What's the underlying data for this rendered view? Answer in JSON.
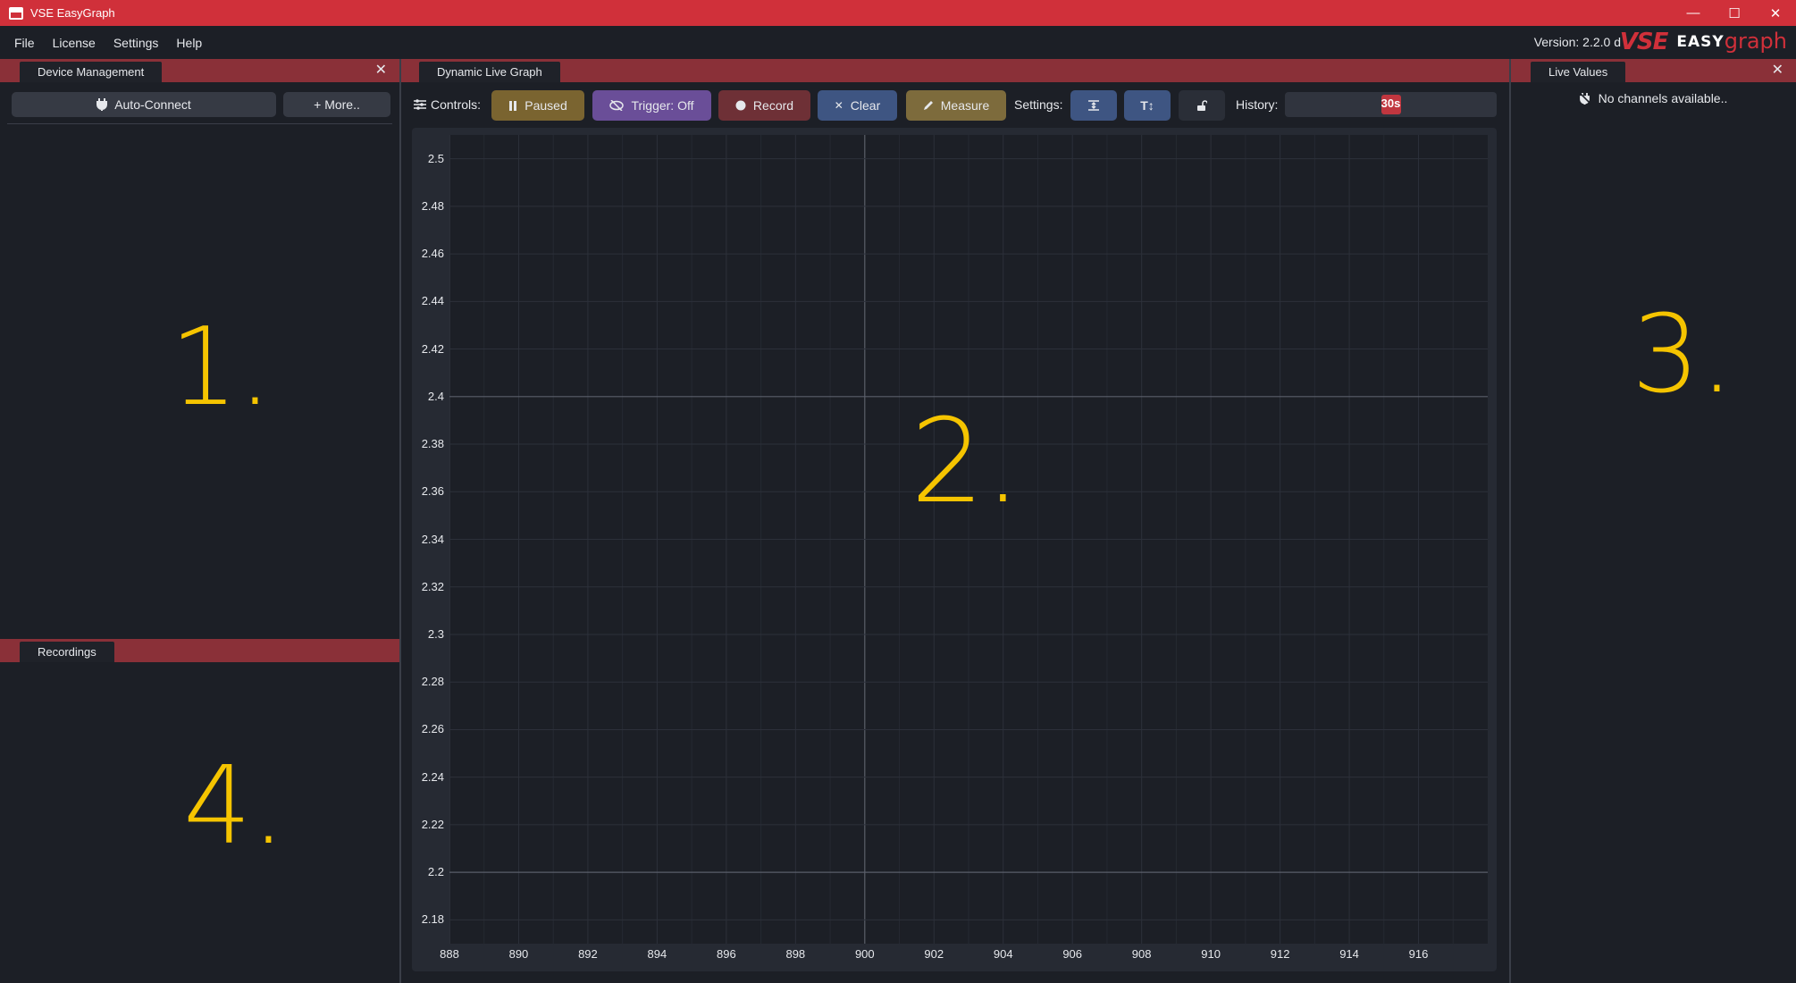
{
  "window": {
    "title": "VSE EasyGraph"
  },
  "menu": [
    "File",
    "License",
    "Settings",
    "Help"
  ],
  "header": {
    "version": "Version: 2.2.0 d",
    "logo_vse": "VSE",
    "logo_easy": "EASY",
    "logo_graph": "graph"
  },
  "device_panel": {
    "tab": "Device Management",
    "auto_connect": "Auto-Connect",
    "more": "+ More..",
    "annotation": "1."
  },
  "recordings_panel": {
    "tab": "Recordings",
    "annotation": "4."
  },
  "graph_panel": {
    "tab": "Dynamic Live Graph",
    "controls_label": "Controls:",
    "paused": "Paused",
    "trigger": "Trigger: Off",
    "record": "Record",
    "clear": "Clear",
    "measure": "Measure",
    "settings_label": "Settings:",
    "history_label": "History:",
    "history_value": "30s",
    "history_fraction": 0.5,
    "annotation": "2."
  },
  "live_values_panel": {
    "tab": "Live Values",
    "empty_text": "No channels available..",
    "annotation": "3."
  },
  "colors": {
    "titlebar": "#d0303a",
    "accent": "#d0303a",
    "annotation": "#f5c400"
  },
  "chart_data": {
    "type": "line",
    "series": [],
    "xlim": [
      888,
      918
    ],
    "ylim": [
      2.17,
      2.51
    ],
    "x_ticks": [
      888,
      890,
      892,
      894,
      896,
      898,
      900,
      902,
      904,
      906,
      908,
      910,
      912,
      914,
      916
    ],
    "y_ticks": [
      "2.5",
      "2.48",
      "2.46",
      "2.44",
      "2.42",
      "2.4",
      "2.38",
      "2.36",
      "2.34",
      "2.32",
      "2.3",
      "2.28",
      "2.26",
      "2.24",
      "2.22",
      "2.2",
      "2.18"
    ],
    "major_y": [
      2.4,
      2.2
    ],
    "major_x": [
      900
    ],
    "grid": true
  }
}
